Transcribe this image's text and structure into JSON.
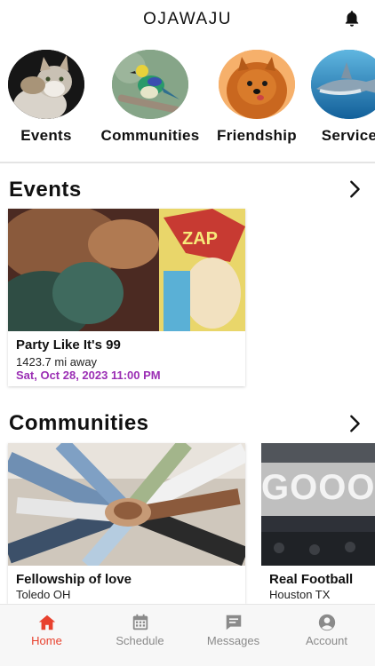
{
  "app": {
    "title": "OJAWAJU"
  },
  "categories": [
    {
      "label": "Events",
      "icon": "cat-photo"
    },
    {
      "label": "Communities",
      "icon": "bird-photo"
    },
    {
      "label": "Friendship",
      "icon": "dog-photo"
    },
    {
      "label": "Service",
      "icon": "shark-photo"
    }
  ],
  "events": {
    "title": "Events",
    "cards": [
      {
        "name": "Party Like It's 99",
        "distance": "1423.7 mi away",
        "date": "Sat, Oct 28, 2023 11:00 PM"
      }
    ]
  },
  "communities": {
    "title": "Communities",
    "cards": [
      {
        "name": "Fellowship of love",
        "location": "Toledo OH"
      },
      {
        "name": "Real Football",
        "location": "Houston TX",
        "banner_text": "GOOOO"
      }
    ]
  },
  "tabs": [
    {
      "label": "Home",
      "icon": "home-icon",
      "active": true
    },
    {
      "label": "Schedule",
      "icon": "calendar-icon",
      "active": false
    },
    {
      "label": "Messages",
      "icon": "message-icon",
      "active": false
    },
    {
      "label": "Account",
      "icon": "account-icon",
      "active": false
    }
  ],
  "colors": {
    "accent": "#e8412e",
    "date": "#9b2fb4"
  }
}
